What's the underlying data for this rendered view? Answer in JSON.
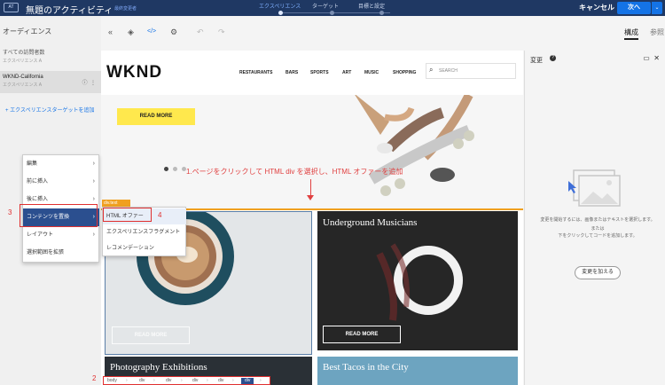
{
  "topbar": {
    "logo": "AT",
    "title": "無題のアクティビティ",
    "status": "最終変更者",
    "steps": [
      "エクスペリエンス",
      "ターゲット",
      "目標と設定"
    ],
    "cancel": "キャンセル",
    "next": "次へ"
  },
  "left": {
    "title": "オーディエンス",
    "audiences": [
      {
        "name": "すべての訪問者数",
        "sub": "エクスペリエンス A"
      },
      {
        "name": "WKND-California",
        "sub": "エクスペリエンス A"
      }
    ],
    "add_target": "+ エクスペリエンスターゲットを追加"
  },
  "toolbar": {
    "tab_compose": "構成",
    "tab_ref": "参照"
  },
  "wknd": {
    "logo": "WKND",
    "nav": [
      "RESTAURANTS",
      "BARS",
      "SPORTS",
      "ART",
      "MUSIC",
      "SHOPPING"
    ],
    "search_placeholder": "SEARCH",
    "hero_button": "READ MORE",
    "cards": [
      {
        "title": "",
        "button": "READ MORE"
      },
      {
        "title": "Underground Musicians",
        "button": "READ MORE"
      },
      {
        "title": "Photography Exhibitions"
      },
      {
        "title": "Best Tacos in the City"
      }
    ]
  },
  "annotations": {
    "instruction": "1.ページをクリックして HTML div を選択し、HTML オファーを追加",
    "n2": "2",
    "n3": "3",
    "n4": "4"
  },
  "context_menu": {
    "items": [
      "編集",
      "前に挿入",
      "後に挿入",
      "コンテンツを置換",
      "レイアウト",
      "選択範囲を拡張"
    ],
    "submenu": [
      "HTML オファー",
      "エクスペリエンスフラグメント",
      "レコメンデーション"
    ],
    "tag": "div.text"
  },
  "breadcrumb": [
    "body",
    "div",
    "div",
    "div",
    "div",
    "div",
    "div"
  ],
  "right": {
    "title": "変更",
    "text1": "変更を開始するには、画像またはテキストを選択します。",
    "text2": "または",
    "text3": "下をクリックしてコードを追加します。",
    "button": "変更を加える"
  }
}
